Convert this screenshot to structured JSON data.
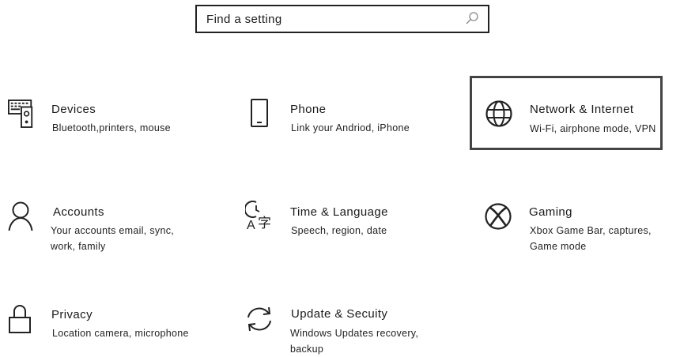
{
  "search": {
    "placeholder": "Find a setting",
    "icon": "search-icon"
  },
  "tiles": [
    {
      "title": "Devices",
      "description": "Bluetooth,printers, mouse",
      "icon": "devices-icon"
    },
    {
      "title": "Phone",
      "description": "Link your Andriod, iPhone",
      "icon": "phone-icon"
    },
    {
      "title": "Network & Internet",
      "description": "Wi-Fi, airphone mode, VPN",
      "icon": "globe-icon",
      "focused": true
    },
    {
      "title": "Accounts",
      "description": "Your accounts email, sync, work, family",
      "icon": "person-icon"
    },
    {
      "title": "Time & Language",
      "description": "Speech, region, date",
      "icon": "time-language-icon"
    },
    {
      "title": "Gaming",
      "description": "Xbox Game Bar, captures, Game mode",
      "icon": "xbox-icon"
    },
    {
      "title": "Privacy",
      "description": "Location camera, microphone",
      "icon": "lock-icon"
    },
    {
      "title": "Update & Secuity",
      "description": "Windows Updates recovery, backup",
      "icon": "sync-icon"
    }
  ]
}
